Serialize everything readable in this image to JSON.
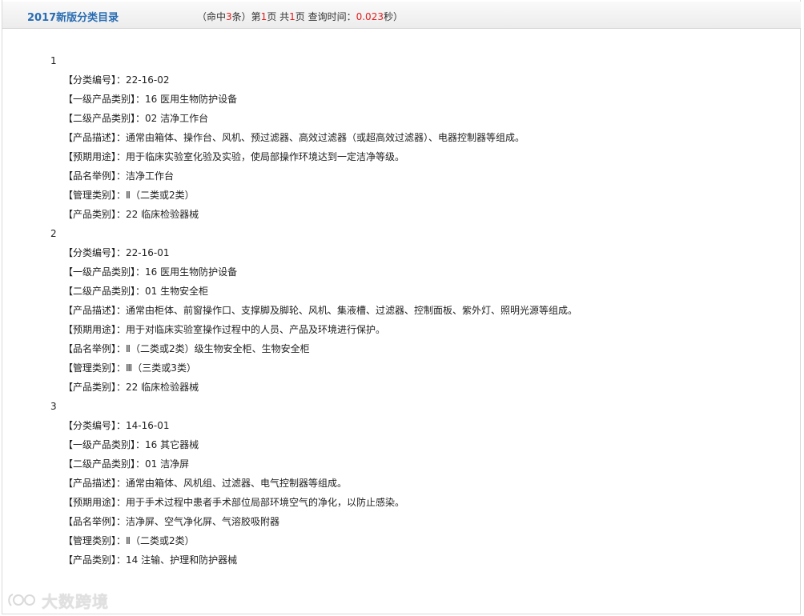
{
  "header": {
    "title": "2017新版分类目录",
    "meta_prefix": "（命中",
    "hits": "3",
    "meta_mid1": "条）第",
    "page": "1",
    "meta_mid2": "页 共",
    "total_pages": "1",
    "meta_mid3": "页 查询时间：",
    "query_time": "0.023",
    "meta_suffix": "秒）"
  },
  "sep": "：",
  "records": [
    {
      "number": "1",
      "fields": [
        {
          "label": "【分类编号】",
          "value": "22-16-02"
        },
        {
          "label": "【一级产品类别】",
          "value": "16 医用生物防护设备"
        },
        {
          "label": "【二级产品类别】",
          "value": "02 洁净工作台"
        },
        {
          "label": "【产品描述】",
          "value": "通常由箱体、操作台、风机、预过滤器、高效过滤器（或超高效过滤器）、电器控制器等组成。"
        },
        {
          "label": "【预期用途】",
          "value": "用于临床实验室化验及实验，使局部操作环境达到一定洁净等级。"
        },
        {
          "label": "【品名举例】",
          "value": "洁净工作台"
        },
        {
          "label": "【管理类别】",
          "value": "Ⅱ（二类或2类）"
        },
        {
          "label": "【产品类别】",
          "value": "22 临床检验器械"
        }
      ]
    },
    {
      "number": "2",
      "fields": [
        {
          "label": "【分类编号】",
          "value": "22-16-01"
        },
        {
          "label": "【一级产品类别】",
          "value": "16 医用生物防护设备"
        },
        {
          "label": "【二级产品类别】",
          "value": "01 生物安全柜"
        },
        {
          "label": "【产品描述】",
          "value": "通常由柜体、前窗操作口、支撑脚及脚轮、风机、集液槽、过滤器、控制面板、紫外灯、照明光源等组成。"
        },
        {
          "label": "【预期用途】",
          "value": "用于对临床实验室操作过程中的人员、产品及环境进行保护。"
        },
        {
          "label": "【品名举例】",
          "value": "Ⅱ（二类或2类）级生物安全柜、生物安全柜"
        },
        {
          "label": "【管理类别】",
          "value": "Ⅲ（三类或3类）"
        },
        {
          "label": "【产品类别】",
          "value": "22 临床检验器械"
        }
      ]
    },
    {
      "number": "3",
      "fields": [
        {
          "label": "【分类编号】",
          "value": "14-16-01"
        },
        {
          "label": "【一级产品类别】",
          "value": "16 其它器械"
        },
        {
          "label": "【二级产品类别】",
          "value": "01 洁净屏"
        },
        {
          "label": "【产品描述】",
          "value": "通常由箱体、风机组、过滤器、电气控制器等组成。"
        },
        {
          "label": "【预期用途】",
          "value": "用于手术过程中患者手术部位局部环境空气的净化，以防止感染。"
        },
        {
          "label": "【品名举例】",
          "value": "洁净屏、空气净化屏、气溶胶吸附器"
        },
        {
          "label": "【管理类别】",
          "value": "Ⅱ（二类或2类）"
        },
        {
          "label": "【产品类别】",
          "value": "14 注输、护理和防护器械"
        }
      ]
    }
  ],
  "watermark": {
    "text": "大数跨境",
    "icon": "logo-icon"
  }
}
